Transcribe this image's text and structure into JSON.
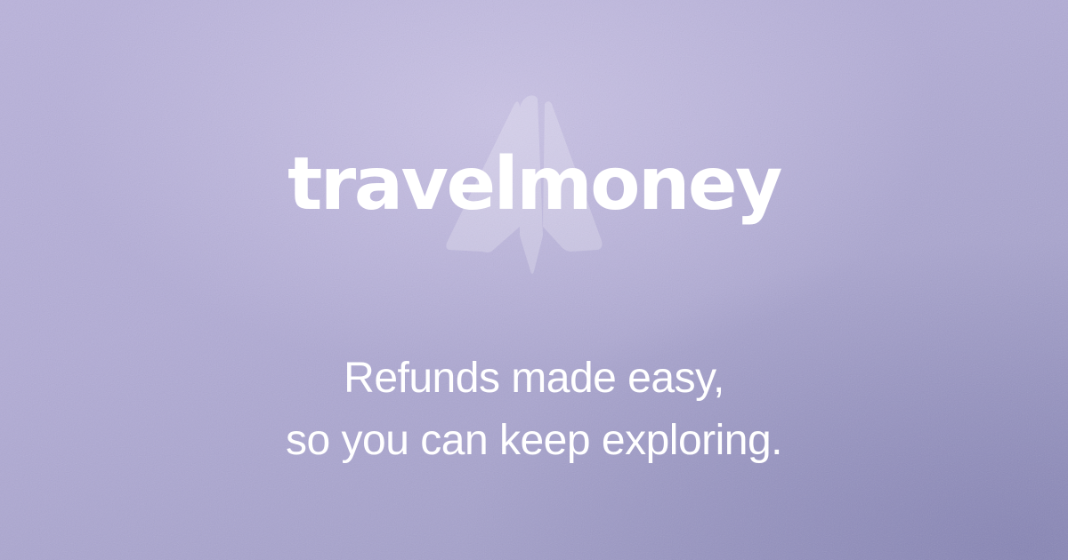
{
  "brand": {
    "name": "travelmoney",
    "logo_icon": "paper-plane-icon"
  },
  "tagline": {
    "line1": "Refunds made easy,",
    "line2": "so you can keep exploring."
  },
  "colors": {
    "background_top": "#c6c0e4",
    "background_bottom": "#9b99c4",
    "text": "#ffffff"
  }
}
